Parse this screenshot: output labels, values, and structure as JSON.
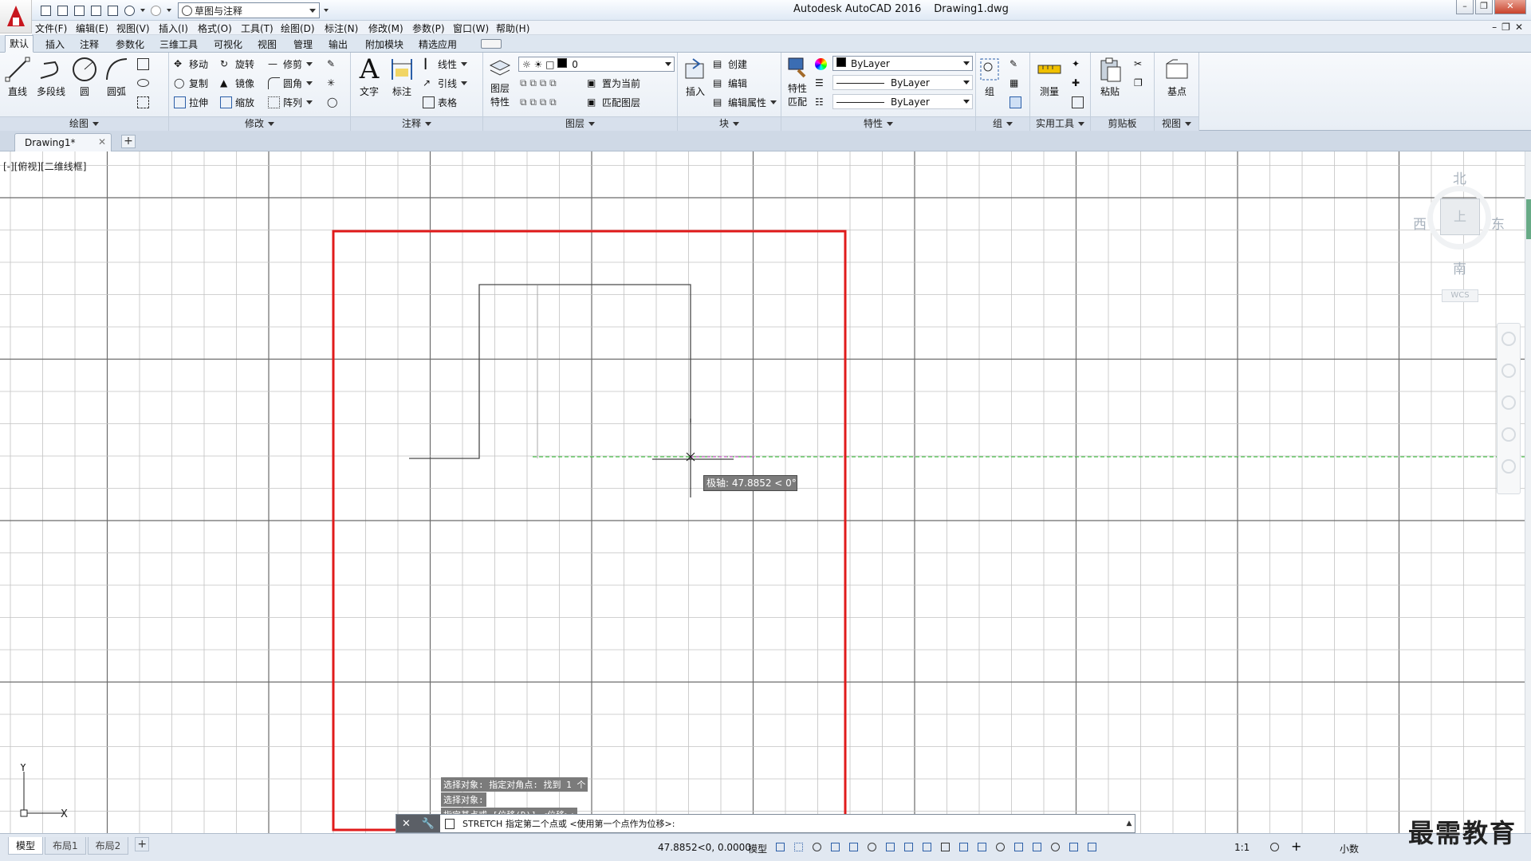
{
  "app": {
    "name": "Autodesk AutoCAD 2016",
    "file": "Drawing1.dwg"
  },
  "qat": {
    "workspace": "草图与注释"
  },
  "menu": [
    "文件(F)",
    "编辑(E)",
    "视图(V)",
    "插入(I)",
    "格式(O)",
    "工具(T)",
    "绘图(D)",
    "标注(N)",
    "修改(M)",
    "参数(P)",
    "窗口(W)",
    "帮助(H)"
  ],
  "ribbon_tabs": [
    "默认",
    "插入",
    "注释",
    "参数化",
    "三维工具",
    "可视化",
    "视图",
    "管理",
    "输出",
    "附加模块",
    "精选应用"
  ],
  "ribbon": {
    "draw": {
      "title": "绘图",
      "line": "直线",
      "polyline": "多段线",
      "circle": "圆",
      "arc": "圆弧"
    },
    "modify": {
      "title": "修改",
      "move": "移动",
      "rotate": "旋转",
      "trim": "修剪",
      "copy": "复制",
      "mirror": "镜像",
      "fillet": "圆角",
      "stretch": "拉伸",
      "scale": "缩放",
      "array": "阵列"
    },
    "annotation": {
      "title": "注释",
      "text": "文字",
      "dim": "标注",
      "linear": "线性",
      "leader": "引线",
      "table": "表格"
    },
    "layers": {
      "title": "图层",
      "layer_props_1": "图层",
      "layer_props_2": "特性",
      "current_layer": "0",
      "set_current": "置为当前",
      "match_layer": "匹配图层"
    },
    "block": {
      "title": "块",
      "insert": "插入",
      "create": "创建",
      "edit": "编辑",
      "edit_attr": "编辑属性"
    },
    "properties": {
      "title": "特性",
      "match_1": "特性",
      "match_2": "匹配",
      "color": "ByLayer",
      "linetype": "ByLayer",
      "lineweight": "ByLayer"
    },
    "groups": {
      "title": "组",
      "group": "组"
    },
    "utilities": {
      "title": "实用工具",
      "measure": "测量"
    },
    "clipboard": {
      "title": "剪贴板",
      "paste": "粘贴"
    },
    "view": {
      "title": "视图",
      "base": "基点"
    }
  },
  "file_tab": {
    "name": "Drawing1*"
  },
  "viewport": {
    "label": "[-][俯视][二维线框]"
  },
  "viewcube": {
    "north": "北",
    "south": "南",
    "east": "东",
    "west": "西",
    "face": "上",
    "wcs": "WCS"
  },
  "command": {
    "history": [
      "选择对象: 指定对角点: 找到 1 个",
      "选择对象:",
      "指定基点或 [位移(D)] <位移>:"
    ],
    "current": "STRETCH 指定第二个点或 <使用第一个点作为位移>:"
  },
  "tooltip": "极轴: 47.8852 < 0°",
  "status": {
    "layouts": [
      "模型",
      "布局1",
      "布局2"
    ],
    "coords": "47.8852<0, 0.0000",
    "space": "模型",
    "scale": "1:1",
    "units": "小数"
  },
  "watermark": "最需教育",
  "colors": {
    "window_crossing": "#e01b1b",
    "polar_track": "#27b827",
    "grid_major": "#6b6b6b",
    "grid_minor": "#c2c2c2"
  }
}
